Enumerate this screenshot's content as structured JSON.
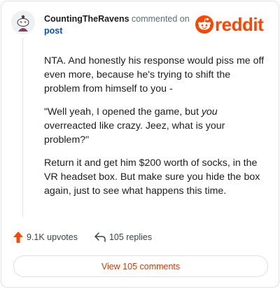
{
  "comment": {
    "username": "CountingTheRavens",
    "action": "commented on",
    "target": "post",
    "paragraphs": [
      {
        "before": "NTA. And honestly his response would piss me off even more, because he's trying to shift the problem from himself to you -",
        "em": "",
        "after": ""
      },
      {
        "before": "\"Well yeah, I opened the game, but ",
        "em": "you",
        "after": " overreacted like crazy. Jeez, what is your problem?\""
      },
      {
        "before": "Return it and get him $200 worth of socks, in the VR headset box. But make sure you hide the box again, just to see what happens this time.",
        "em": "",
        "after": ""
      }
    ]
  },
  "brand": {
    "name": "reddit",
    "color": "#ff4500"
  },
  "stats": {
    "upvotes": "9.1K upvotes",
    "replies": "105 replies"
  },
  "view_button": "View 105 comments",
  "icons": {
    "upvote": "upvote-arrow-icon",
    "reply": "reply-arrow-icon",
    "logo": "reddit-snoo-icon",
    "avatar": "user-avatar"
  }
}
